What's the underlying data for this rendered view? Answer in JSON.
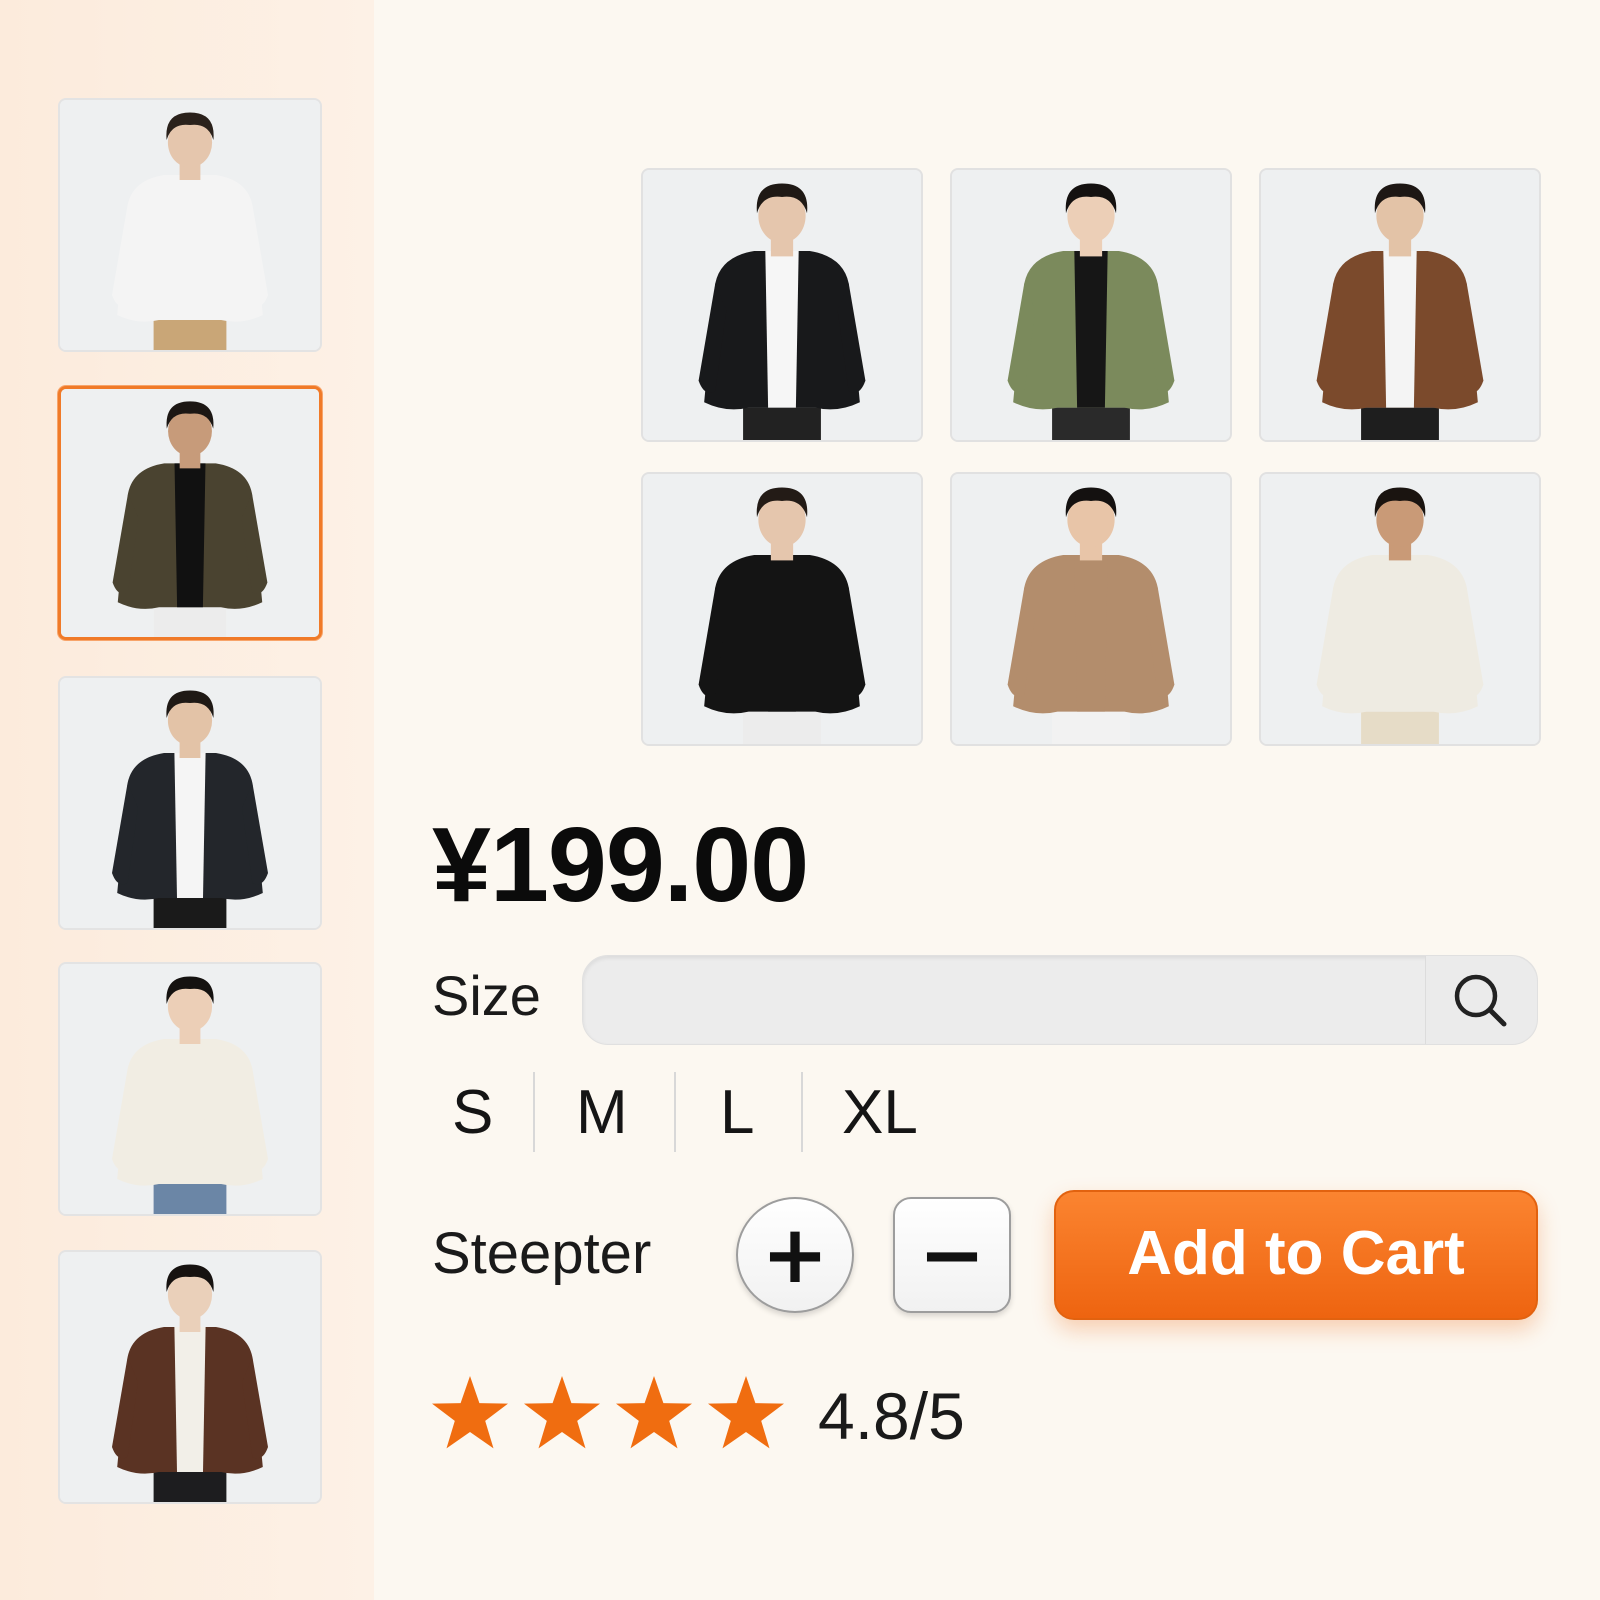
{
  "sidebar": {
    "thumbnails": [
      {
        "item": "white hoodie",
        "hair": "#2a211b",
        "skin": "#e5c6ad",
        "top": "#f4f4f4",
        "inner": "#f4f4f4",
        "bottom": "#c9a677",
        "selected": false
      },
      {
        "item": "olive jacket",
        "hair": "#1c1714",
        "skin": "#c79b7a",
        "top": "#4a4330",
        "inner": "#111111",
        "bottom": "#ececec",
        "selected": true
      },
      {
        "item": "black hooded jacket",
        "hair": "#1f1915",
        "skin": "#e3c3a7",
        "top": "#23262b",
        "inner": "#f5f5f5",
        "bottom": "#1a1a1a",
        "selected": false
      },
      {
        "item": "cream cardigan",
        "hair": "#151210",
        "skin": "#eccfb7",
        "top": "#f1ede3",
        "inner": "#f1ede3",
        "bottom": "#6b86a6",
        "selected": false
      },
      {
        "item": "brown jacket",
        "hair": "#161210",
        "skin": "#ead0ba",
        "top": "#5a3323",
        "inner": "#f2efe8",
        "bottom": "#1d1d1f",
        "selected": false
      }
    ]
  },
  "gallery": {
    "tiles": [
      {
        "item": "black bomber jacket",
        "hair": "#1f1915",
        "skin": "#e5c6ad",
        "top": "#18191b",
        "inner": "#f6f6f6",
        "bottom": "#222222"
      },
      {
        "item": "green utility jacket",
        "hair": "#141110",
        "skin": "#eccfb7",
        "top": "#7b8a5c",
        "inner": "#161616",
        "bottom": "#2a2a2a"
      },
      {
        "item": "brown hooded jacket",
        "hair": "#1d1714",
        "skin": "#e3c3a7",
        "top": "#7b4a2c",
        "inner": "#f4f4f4",
        "bottom": "#1e1e1e"
      },
      {
        "item": "black hoodie",
        "hair": "#231b16",
        "skin": "#e5c6ad",
        "top": "#141414",
        "inner": "#141414",
        "bottom": "#ececec"
      },
      {
        "item": "tan tank top",
        "hair": "#141110",
        "skin": "#e8c5a8",
        "top": "#b38d6c",
        "inner": "#b38d6c",
        "bottom": "#f2f2f2"
      },
      {
        "item": "cream knit shirt",
        "hair": "#1a1410",
        "skin": "#c99a77",
        "top": "#eeebe2",
        "inner": "#eeebe2",
        "bottom": "#e6dcc7"
      }
    ]
  },
  "product": {
    "price": "¥199.00",
    "size_label": "Size",
    "search_value": "",
    "search_icon": "search-icon",
    "sizes": [
      "S",
      "M",
      "L",
      "XL"
    ],
    "stepper_label": "Steepter",
    "plus_label": "+",
    "minus_label": "−",
    "cart_label": "Add to Cart",
    "rating_text": "4.8/5",
    "rating_value": 4.8,
    "rating_stars_shown": 4
  },
  "colors": {
    "accent": "#f07a28",
    "star": "#f06d10",
    "cart_top": "#fb8430",
    "cart_bottom": "#ee6410"
  }
}
